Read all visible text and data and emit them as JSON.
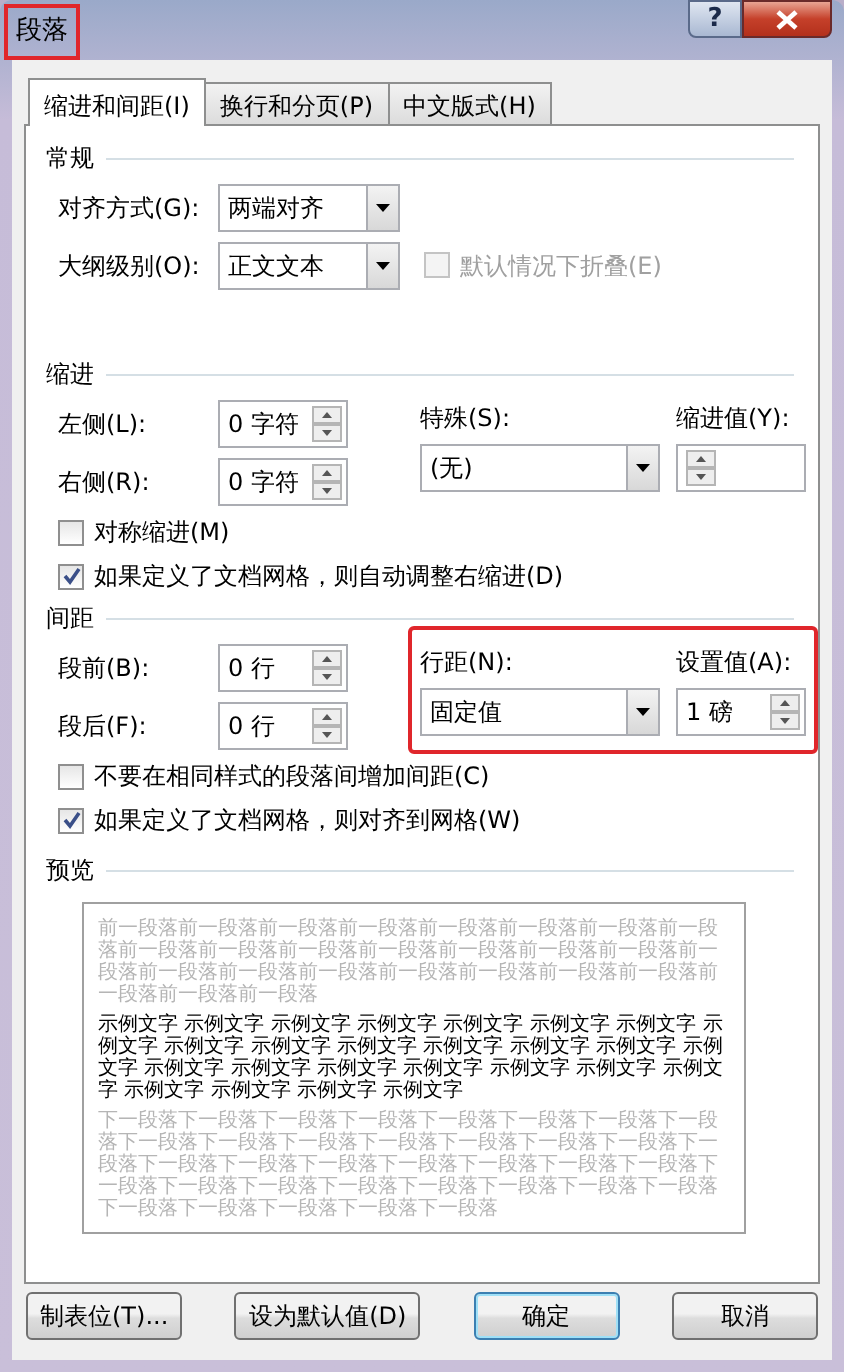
{
  "window": {
    "title": "段落",
    "title_highlighted": true,
    "help": "?"
  },
  "tabs": [
    {
      "label": "缩进和间距(I)",
      "selected": true
    },
    {
      "label": "换行和分页(P)",
      "selected": false
    },
    {
      "label": "中文版式(H)",
      "selected": false
    }
  ],
  "general": {
    "heading": "常规",
    "alignment": {
      "label": "对齐方式(G):",
      "value": "两端对齐"
    },
    "outline_level": {
      "label": "大纲级别(O):",
      "value": "正文文本"
    },
    "collapse": {
      "label": "默认情况下折叠(E)",
      "checked": false,
      "disabled": true
    }
  },
  "indent": {
    "heading": "缩进",
    "left": {
      "label": "左侧(L):",
      "value": "0 字符"
    },
    "right": {
      "label": "右侧(R):",
      "value": "0 字符"
    },
    "special": {
      "label": "特殊(S):",
      "value": "(无)"
    },
    "by": {
      "label": "缩进值(Y):"
    },
    "checkboxes": [
      {
        "label": "对称缩进(M)",
        "checked": false
      },
      {
        "label": "如果定义了文档网格，则自动调整右缩进(D)",
        "checked": true
      }
    ]
  },
  "spacing": {
    "heading": "间距",
    "before": {
      "label": "段前(B):",
      "value": "0 行"
    },
    "after": {
      "label": "段后(F):",
      "value": "0 行"
    },
    "line_spacing": {
      "label": "行距(N):",
      "value": "固定值",
      "highlighted": true
    },
    "at": {
      "label": "设置值(A):",
      "value": "1 磅"
    },
    "checkboxes": [
      {
        "label": "不要在相同样式的段落间增加间距(C)",
        "checked": false
      },
      {
        "label": "如果定义了文档网格，则对齐到网格(W)",
        "checked": true
      }
    ]
  },
  "preview": {
    "heading": "预览",
    "before": "前一段落前一段落前一段落前一段落前一段落前一段落前一段落前一段落前一段落前一段落前一段落前一段落前一段落前一段落前一段落前一段落前一段落前一段落前一段落前一段落前一段落前一段落前一段落前一段落前一段落前一段落",
    "sample": "示例文字 示例文字 示例文字 示例文字 示例文字 示例文字 示例文字 示例文字 示例文字 示例文字 示例文字 示例文字 示例文字 示例文字 示例文字 示例文字 示例文字 示例文字 示例文字 示例文字 示例文字 示例文字 示例文字 示例文字 示例文字 示例文字",
    "after": "下一段落下一段落下一段落下一段落下一段落下一段落下一段落下一段落下一段落下一段落下一段落下一段落下一段落下一段落下一段落下一段落下一段落下一段落下一段落下一段落下一段落下一段落下一段落下一段落下一段落下一段落下一段落下一段落下一段落下一段落下一段落下一段落下一段落下一段落下一段落下一段落"
  },
  "buttons": [
    {
      "label": "制表位(T)...",
      "default": false
    },
    {
      "label": "设为默认值(D)",
      "default": false
    },
    {
      "label": "确定",
      "default": true
    },
    {
      "label": "取消",
      "default": false
    }
  ]
}
